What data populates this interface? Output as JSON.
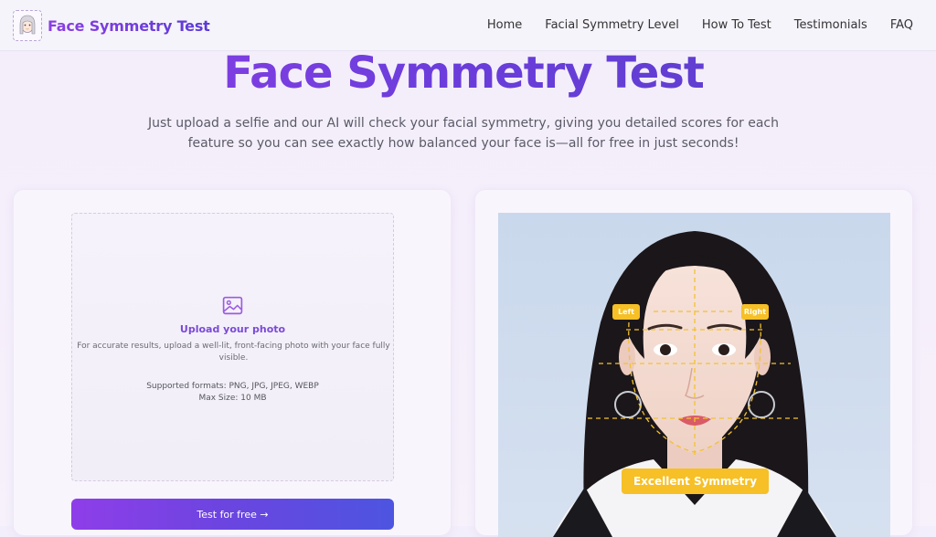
{
  "header": {
    "brand": "Face Symmetry Test",
    "nav": [
      "Home",
      "Facial Symmetry Level",
      "How To Test",
      "Testimonials",
      "FAQ"
    ]
  },
  "hero": {
    "title": "Face Symmetry Test",
    "subtitle": "Just upload a selfie and our AI will check your facial symmetry, giving you detailed scores for each feature so you can see exactly how balanced your face is—all for free in just seconds!"
  },
  "upload": {
    "icon": "image-icon",
    "title": "Upload your photo",
    "description": "For accurate results, upload a well-lit, front-facing photo with your face fully visible.",
    "formats": "Supported formats: PNG, JPG, JPEG, WEBP",
    "max_size": "Max Size: 10 MB",
    "button": "Test for free →"
  },
  "preview": {
    "left_label": "Left",
    "right_label": "Right",
    "result_label": "Excellent Symmetry"
  },
  "colors": {
    "brand_purple": "#8b3fe3",
    "accent_blue": "#4d55e0",
    "guide_yellow": "#f6c026"
  }
}
